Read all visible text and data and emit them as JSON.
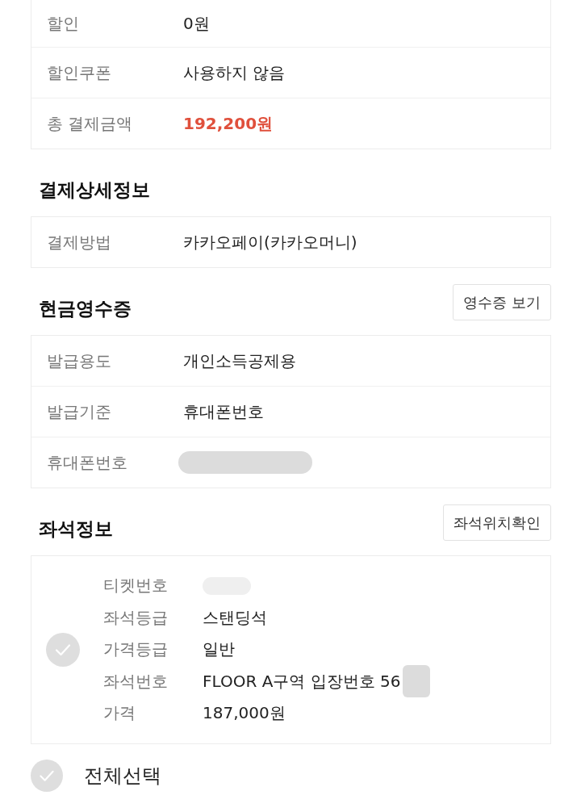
{
  "price_summary": {
    "rows": [
      {
        "label": "할인",
        "value": "0원",
        "kind": "plain"
      },
      {
        "label": "할인쿠폰",
        "value": "사용하지 않음",
        "kind": "plain"
      },
      {
        "label": "총 결제금액",
        "value": "192,200원",
        "kind": "total"
      }
    ]
  },
  "payment_details": {
    "title": "결제상세정보",
    "rows": [
      {
        "label": "결제방법",
        "value": "카카오페이(카카오머니)",
        "kind": "plain"
      }
    ]
  },
  "cash_receipt": {
    "title": "현금영수증",
    "button": "영수증 보기",
    "rows": [
      {
        "label": "발급용도",
        "value": "개인소득공제용",
        "kind": "plain"
      },
      {
        "label": "발급기준",
        "value": "휴대폰번호",
        "kind": "plain"
      },
      {
        "label": "휴대폰번호",
        "kind": "redacted"
      }
    ]
  },
  "seat_info": {
    "title": "좌석정보",
    "button": "좌석위치확인",
    "tickets": [
      {
        "checked": false,
        "fields": [
          {
            "label": "티켓번호",
            "kind": "redacted"
          },
          {
            "label": "좌석등급",
            "value": "스탠딩석",
            "kind": "plain"
          },
          {
            "label": "가격등급",
            "value": "일반",
            "kind": "plain"
          },
          {
            "label": "좌석번호",
            "value": "FLOOR A구역 입장번호 56",
            "kind": "partly_redacted"
          },
          {
            "label": "가격",
            "value": "187,000원",
            "kind": "plain"
          }
        ]
      }
    ]
  },
  "select_all": {
    "label": "전체선택",
    "checked": false
  }
}
